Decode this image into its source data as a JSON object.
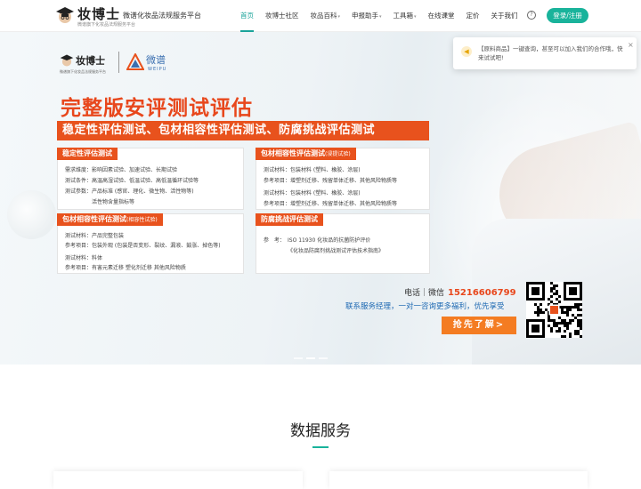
{
  "nav": {
    "logo_name": "妆博士",
    "logo_sub": "微谱旗下化妆品法规服务平台",
    "tagline": "微谱化妆品法规服务平台",
    "items": [
      {
        "label": "首页",
        "active": true,
        "dropdown": false
      },
      {
        "label": "妆博士社区",
        "active": false,
        "dropdown": false
      },
      {
        "label": "妆品百科",
        "active": false,
        "dropdown": true
      },
      {
        "label": "申报助手",
        "active": false,
        "dropdown": true
      },
      {
        "label": "工具箱",
        "active": false,
        "dropdown": true
      },
      {
        "label": "在线课堂",
        "active": false,
        "dropdown": false
      },
      {
        "label": "定价",
        "active": false,
        "dropdown": false
      },
      {
        "label": "关于我们",
        "active": false,
        "dropdown": false
      }
    ],
    "help_icon": "question-circle-icon",
    "login_label": "登录/注册"
  },
  "hero": {
    "brand1_name": "妆博士",
    "brand1_sub": "微谱旗下化妆品法规服务平台",
    "brand2_name": "微谱",
    "brand2_sub": "WEIPU",
    "title": "完整版安评测试评估",
    "subtitle": "稳定性评估测试、包材相容性评估测试、防腐挑战评估测试",
    "cards": [
      {
        "header": "稳定性评估测试",
        "header_note": "",
        "lines": [
          "需求维度：影响因素试验、加速试验、长期试验",
          "测试条件：高温高湿试验、低温试验、高低温循环试验等",
          "测试参数：产品标准 (感官、理化、微生物、活性物等)",
          "　　　　　活性物含量指标等"
        ]
      },
      {
        "header": "包材相容性评估测试",
        "header_note": "(浸提试验)",
        "lines": [
          "测试材料：包装材料 (塑料、橡胶、涂层)",
          "参考项目：增塑剂迁移、残留单体迁移、其他风险物质等",
          "测试材料：包装材料 (塑料、橡胶、涂层)",
          "参考项目：增塑剂迁移、残留单体迁移、其他风险物质等"
        ]
      },
      {
        "header": "包材相容性评估测试",
        "header_note": "(相容性试验)",
        "lines": [
          "测试材料：产品完整包装",
          "参考项目：包装外观 (包装是否变形、裂纹、漏液、鼓涨、掉色等)",
          "测试材料：料体",
          "参考项目：有害元素迁移  塑化剂迁移  其他风险物质"
        ]
      },
      {
        "header": "防腐挑战评估测试",
        "header_note": "",
        "lines": [
          "参　考：　ISO 11930 化妆品的抗菌防护评价",
          "　　　　　《化妆品防腐剂挑战测试评估技术指南》"
        ]
      }
    ],
    "contact_label": "电话｜微信",
    "phone": "15216606799",
    "contact_line": "联系服务经理，一对一咨询更多福利，优先享受",
    "cta_label": "抢先了解>"
  },
  "notice": {
    "icon": "megaphone-icon",
    "text": "【原料商品】一键查询，甚至可以加入我们的合作哦，快来试试吧!",
    "close": "×"
  },
  "section": {
    "title": "数据服务"
  },
  "colors": {
    "brand_teal": "#19b39b",
    "accent_orange": "#e8521d",
    "link_blue": "#1f6ab3"
  }
}
